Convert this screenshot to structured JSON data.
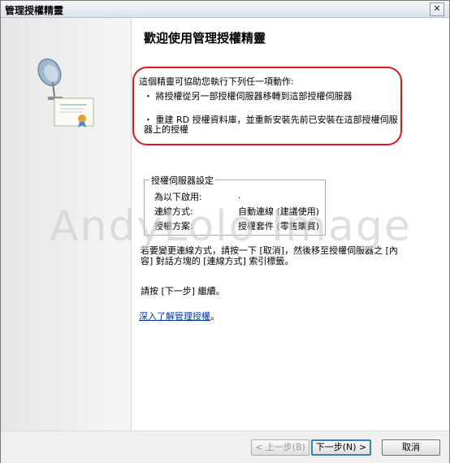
{
  "window": {
    "title": "管理授權精靈",
    "close_glyph": "✕"
  },
  "welcome": {
    "heading": "歡迎使用管理授權精靈",
    "intro": "這個精靈可協助您執行下列任一項動作:",
    "bullets": [
      "・ 將授權從另一部授權伺服器移轉到這部授權伺服器",
      "・ 重建 RD 授權資料庫，並重新安裝先前已安裝在這部授權伺服器上的授權"
    ]
  },
  "server_settings": {
    "legend": "授權伺服器設定",
    "rows": [
      {
        "label": "為以下啟用:",
        "value": "."
      },
      {
        "label": "連線方式:",
        "value": "自動連線 (建議使用)"
      },
      {
        "label": "授權方案:",
        "value": "授權套件 (零售購買)"
      }
    ]
  },
  "note": "若要變更連線方式，請按一下 [取消]，然後移至授權伺服器之 [內容] 對話方塊的 [連線方式] 索引標籤。",
  "continue_text": "請按 [下一步] 繼續。",
  "learn_more": {
    "link_text": "深入了解管理授權",
    "suffix": "。"
  },
  "watermark": "AndyLolo Image",
  "buttons": {
    "back": "< 上一步(B)",
    "next": "下一步(N) >",
    "cancel": "取消"
  },
  "colors": {
    "highlight": "#d81a1a",
    "link": "#0033aa"
  }
}
